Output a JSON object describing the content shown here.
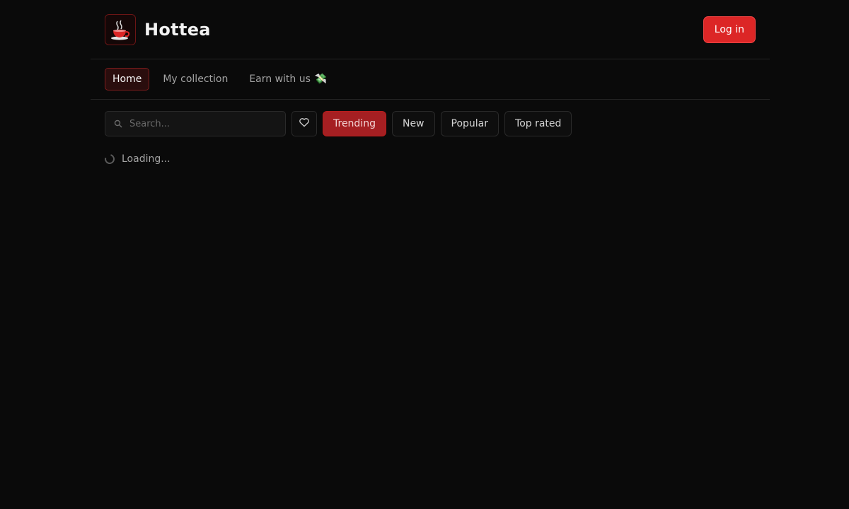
{
  "header": {
    "brand_name": "Hottea",
    "logo_icon": "coffee-cup-icon",
    "login_label": "Log in"
  },
  "nav": {
    "items": [
      {
        "label": "Home",
        "active": true
      },
      {
        "label": "My collection",
        "active": false
      },
      {
        "label": "Earn with us",
        "active": false,
        "emoji": "💸"
      }
    ]
  },
  "toolbar": {
    "search_placeholder": "Search...",
    "favorites_icon": "heart-icon",
    "filters": [
      {
        "label": "Trending",
        "active": true
      },
      {
        "label": "New",
        "active": false
      },
      {
        "label": "Popular",
        "active": false
      },
      {
        "label": "Top rated",
        "active": false
      }
    ]
  },
  "status": {
    "loading_text": "Loading..."
  },
  "colors": {
    "accent": "#dc2626",
    "active_filter": "#a51f22",
    "background": "#0a0a0a"
  }
}
